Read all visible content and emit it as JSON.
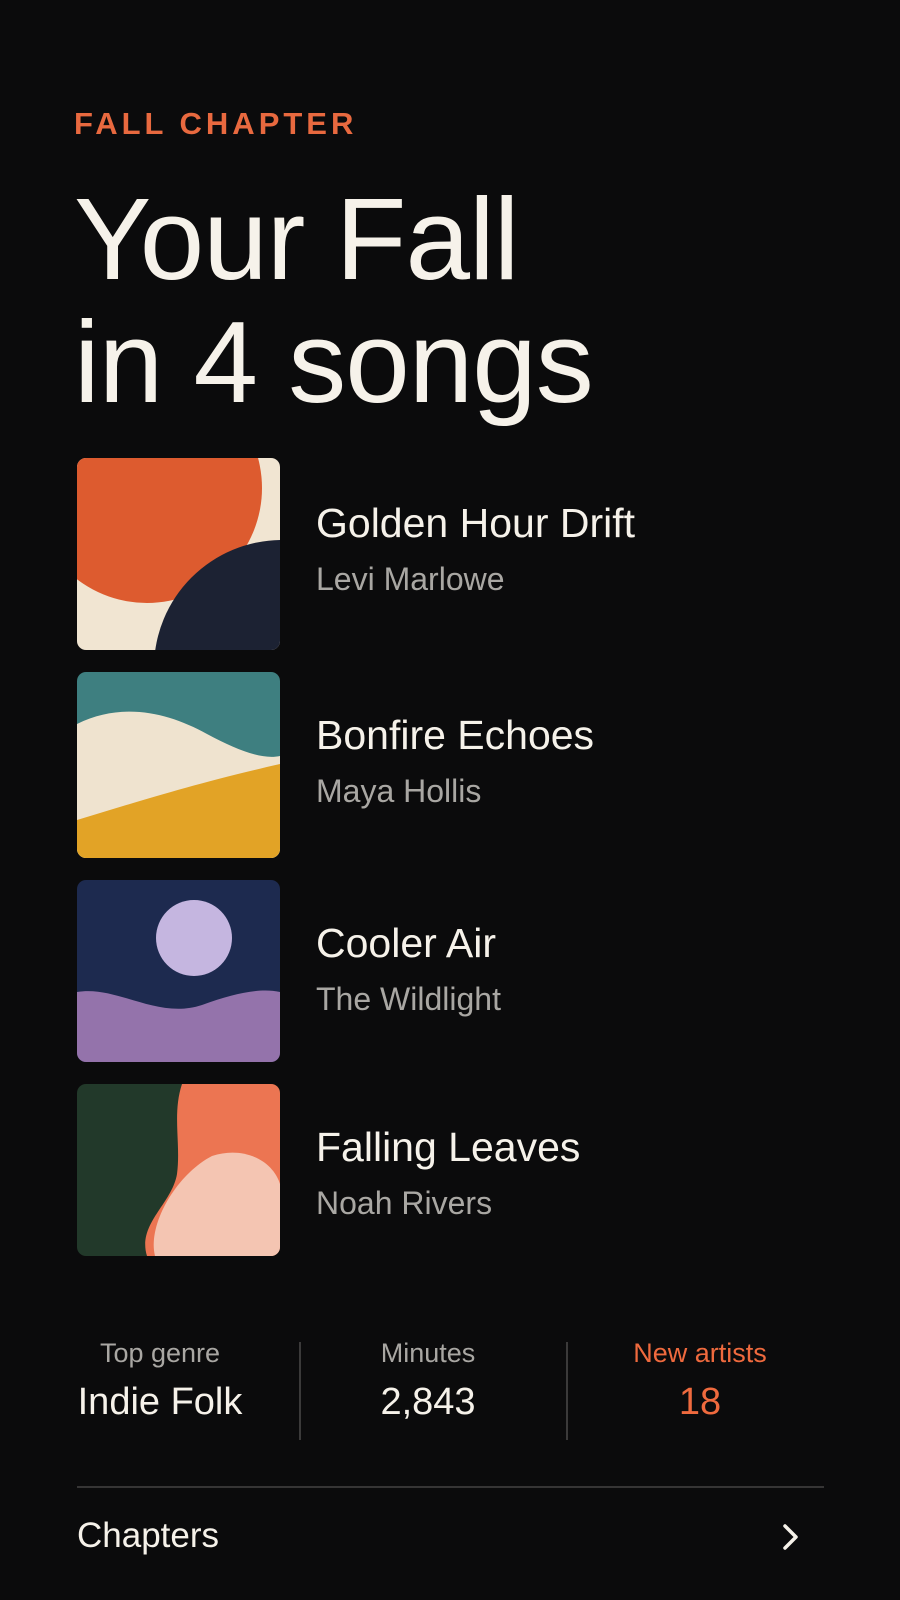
{
  "header": {
    "eyebrow": "FALL CHAPTER",
    "title_line1": "Your Fall",
    "title_line2": "in 4 songs"
  },
  "tracks": [
    {
      "title": "Golden Hour Drift",
      "artist": "Levi Marlowe",
      "art": "orange-sun-cream-navy-art"
    },
    {
      "title": "Bonfire Echoes",
      "artist": "Maya Hollis",
      "art": "teal-cream-mustard-wave-art"
    },
    {
      "title": "Cooler Air",
      "artist": "The Wildlight",
      "art": "navy-moon-lavender-hills-art"
    },
    {
      "title": "Falling Leaves",
      "artist": "Noah Rivers",
      "art": "green-coral-blush-shapes-art"
    }
  ],
  "stats": {
    "genre": {
      "label": "Top genre",
      "value": "Indie Folk"
    },
    "minutes": {
      "label": "Minutes",
      "value": "2,843"
    },
    "new_artists": {
      "label": "New artists",
      "value": "18"
    }
  },
  "footer": {
    "chapters_label": "Chapters",
    "chevron_icon": "chevron-right-icon"
  },
  "colors": {
    "background": "#0b0b0c",
    "accent": "#ef6a3e",
    "text_primary": "#f6f2ea",
    "text_secondary": "#a9a7a3"
  }
}
